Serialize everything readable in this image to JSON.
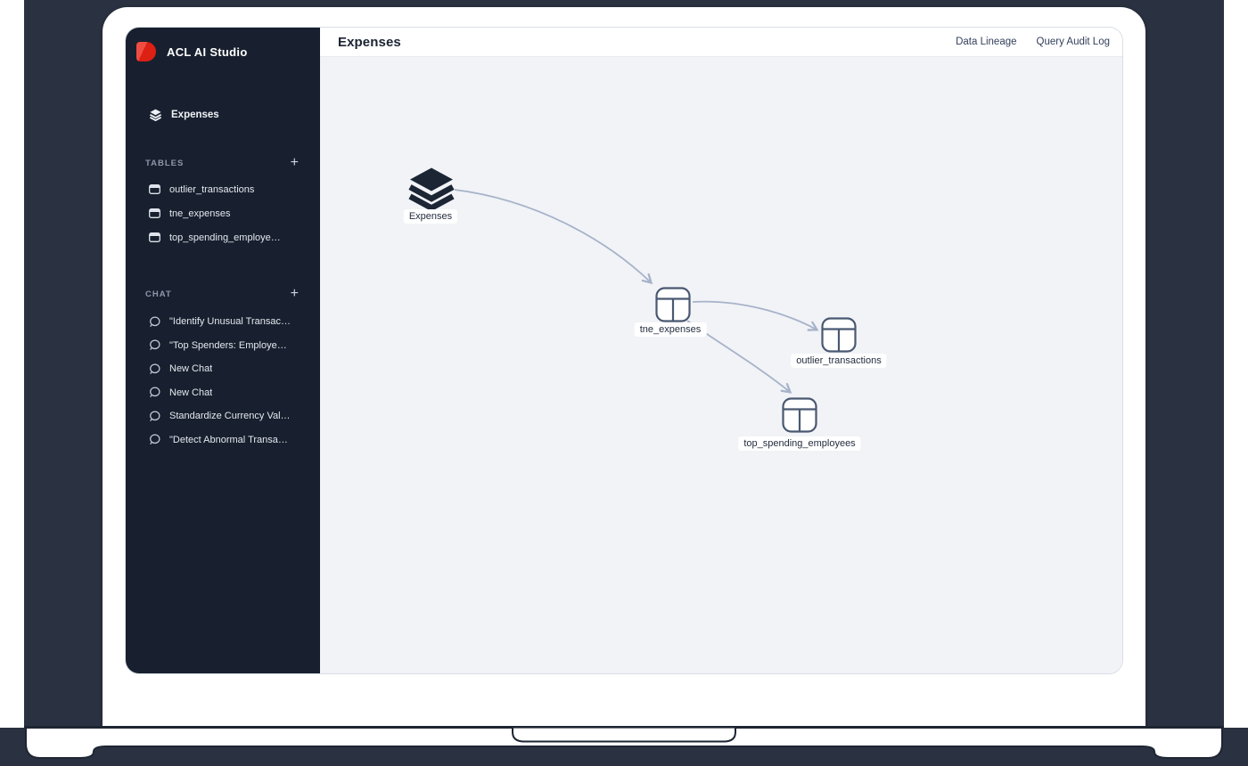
{
  "brand": {
    "name": "ACL AI Studio"
  },
  "sidebar": {
    "nav_expenses": "Expenses",
    "tables": {
      "title": "TABLES",
      "add": "+",
      "items": [
        "outlier_transactions",
        "tne_expenses",
        "top_spending_employe…"
      ]
    },
    "chat": {
      "title": "CHAT",
      "add": "+",
      "items": [
        "\"Identify Unusual Transac…",
        "\"Top Spenders: Employe…",
        "New Chat",
        "New Chat",
        "Standardize Currency Val…",
        "\"Detect Abnormal Transa…"
      ]
    }
  },
  "header": {
    "title": "Expenses",
    "links": [
      "Data Lineage",
      "Query Audit Log"
    ]
  },
  "canvas": {
    "nodes": [
      {
        "id": "expenses",
        "label": "Expenses",
        "kind": "dataset"
      },
      {
        "id": "tne_expenses",
        "label": "tne_expenses",
        "kind": "table"
      },
      {
        "id": "outlier_transactions",
        "label": "outlier_transactions",
        "kind": "table"
      },
      {
        "id": "top_spending_employees",
        "label": "top_spending_employees",
        "kind": "table"
      }
    ],
    "edges": [
      {
        "from": "expenses",
        "to": "tne_expenses"
      },
      {
        "from": "tne_expenses",
        "to": "outlier_transactions"
      },
      {
        "from": "tne_expenses",
        "to": "top_spending_employees"
      }
    ]
  },
  "colors": {
    "brand_red": "#e0281e",
    "sidebar_bg": "#18202f",
    "backdrop": "#2a3140",
    "canvas_bg": "#f2f3f7",
    "edge": "#a6b3c9",
    "node_stroke": "#495871",
    "title_text": "#1b2433"
  }
}
